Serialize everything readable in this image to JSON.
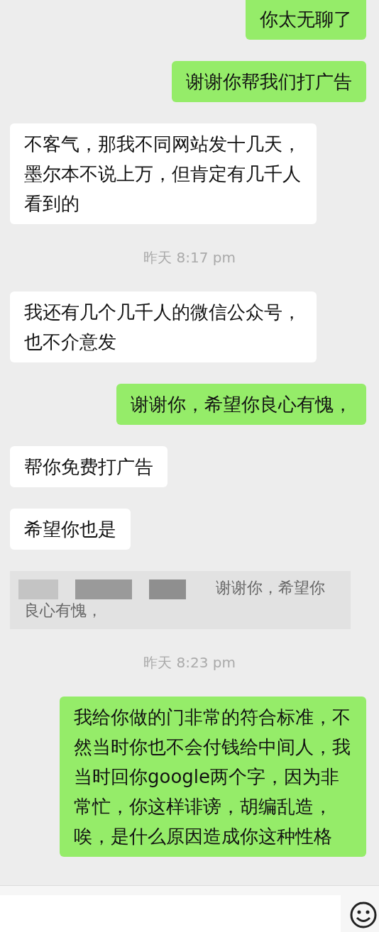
{
  "messages": [
    {
      "kind": "sent",
      "text": "你太无聊了"
    },
    {
      "kind": "sent",
      "text": "谢谢你帮我们打广告"
    },
    {
      "kind": "received",
      "text": "不客气，那我不同网站发十几天，墨尔本不说上万，但肯定有几千人看到的"
    },
    {
      "kind": "time",
      "text": "昨天 8:17 pm"
    },
    {
      "kind": "received",
      "text": "我还有几个几千人的微信公众号，也不介意发"
    },
    {
      "kind": "sent",
      "text": "谢谢你，希望你良心有愧，"
    },
    {
      "kind": "received",
      "text": "帮你免费打广告"
    },
    {
      "kind": "received",
      "text": "希望你也是"
    },
    {
      "kind": "quote",
      "text": "谢谢你，希望你良心有愧，"
    },
    {
      "kind": "time",
      "text": "昨天 8:23 pm"
    },
    {
      "kind": "sent",
      "text": "我给你做的门非常的符合标准，不然当时你也不会付钱给中间人，我当时回你google两个字，因为非常忙，你这样诽谤，胡编乱造，唉，是什么原因造成你这种性格"
    }
  ],
  "input_bar": {
    "kind": "text"
  }
}
